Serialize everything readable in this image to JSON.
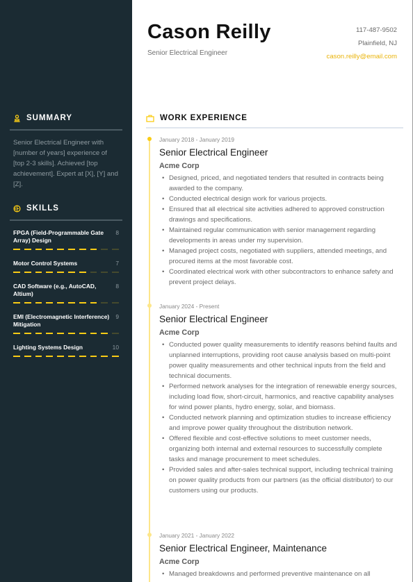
{
  "header": {
    "name": "Cason Reilly",
    "role": "Senior Electrical Engineer",
    "phone": "117-487-9502",
    "location": "Plainfield, NJ",
    "email": "cason.reilly@email.com"
  },
  "colors": {
    "sidebar_bg": "#1b2b33",
    "accent": "#facc15",
    "accent_dim": "#454a2e"
  },
  "summary": {
    "title": "SUMMARY",
    "icon": "person-stamp-icon",
    "text": "Senior Electrical Engineer with [number of years] experience of [top 2-3 skills]. Achieved [top achievement]. Expert at [X], [Y] and [Z]."
  },
  "skills": {
    "title": "SKILLS",
    "icon": "skills-circle-icon",
    "max": 10,
    "items": [
      {
        "name": "FPGA (Field-Programmable Gate Array) Design",
        "score": 8
      },
      {
        "name": "Motor Control Systems",
        "score": 7
      },
      {
        "name": "CAD Software (e.g., AutoCAD, Altium)",
        "score": 8
      },
      {
        "name": "EMI (Electromagnetic Interference) Mitigation",
        "score": 9
      },
      {
        "name": "Lighting Systems Design",
        "score": 10
      }
    ]
  },
  "experience": {
    "title": "WORK EXPERIENCE",
    "icon": "briefcase-icon",
    "jobs": [
      {
        "date": "January 2018 - January 2019",
        "title": "Senior Electrical Engineer",
        "company": "Acme Corp",
        "bullets": [
          "Designed, priced, and negotiated tenders that resulted in contracts being awarded to the company.",
          "Conducted electrical design work for various projects.",
          "Ensured that all electrical site activities adhered to approved construction drawings and specifications.",
          "Maintained regular communication with senior management regarding developments in areas under my supervision.",
          "Managed project costs, negotiated with suppliers, attended meetings, and procured items at the most favorable cost.",
          "Coordinated electrical work with other subcontractors to enhance safety and prevent project delays."
        ]
      },
      {
        "date": "January 2024 - Present",
        "title": "Senior Electrical Engineer",
        "company": "Acme Corp",
        "bullets": [
          "Conducted power quality measurements to identify reasons behind faults and unplanned interruptions, providing root cause analysis based on multi-point power quality measurements and other technical inputs from the field and technical documents.",
          "Performed network analyses for the integration of renewable energy sources, including load flow, short-circuit, harmonics, and reactive capability analyses for wind power plants, hydro energy, solar, and biomass.",
          "Conducted network planning and optimization studies to increase efficiency and improve power quality throughout the distribution network.",
          "Offered flexible and cost-effective solutions to meet customer needs, organizing both internal and external resources to successfully complete tasks and manage procurement to meet schedules.",
          "Provided sales and after-sales technical support, including technical training on power quality products from our partners (as the official distributor) to our customers using our products."
        ]
      },
      {
        "date": "January 2021 - January 2022",
        "title": "Senior Electrical Engineer, Maintenance",
        "company": "Acme Corp",
        "bullets": [
          "Managed breakdowns and performed preventive maintenance on all"
        ]
      }
    ]
  }
}
